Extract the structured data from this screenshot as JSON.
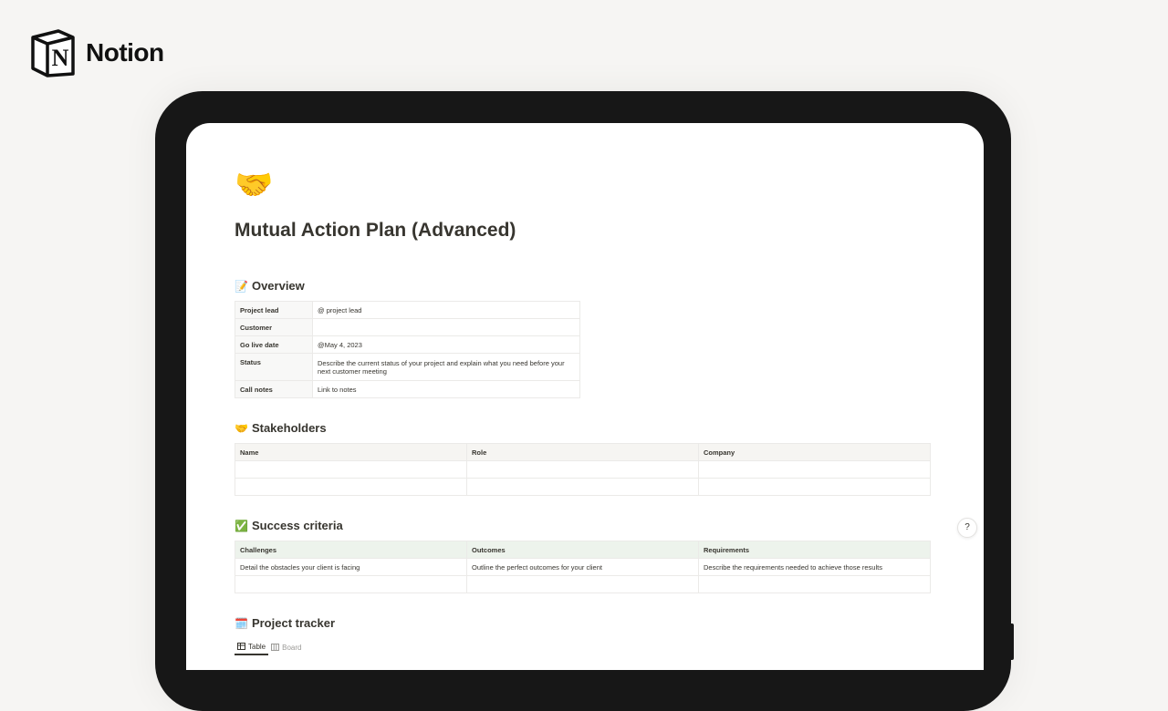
{
  "brand": {
    "name": "Notion",
    "logo_icon": "notion-logo-icon"
  },
  "page": {
    "emoji": "🤝",
    "title": "Mutual Action Plan (Advanced)"
  },
  "overview": {
    "heading": "Overview",
    "emoji": "📝",
    "rows": [
      {
        "key": "Project lead",
        "value": "@ project lead"
      },
      {
        "key": "Customer",
        "value": ""
      },
      {
        "key": "Go live date",
        "value": "@May 4, 2023"
      },
      {
        "key": "Status",
        "value": "Describe the current status of your project and explain what you need before your next customer meeting"
      },
      {
        "key": "Call notes",
        "value": "Link to notes"
      }
    ]
  },
  "stakeholders": {
    "heading": "Stakeholders",
    "emoji": "🤝",
    "columns": [
      "Name",
      "Role",
      "Company"
    ]
  },
  "success": {
    "heading": "Success criteria",
    "emoji": "✅",
    "columns": [
      "Challenges",
      "Outcomes",
      "Requirements"
    ],
    "rows": [
      [
        "Detail the obstacles your client is facing",
        "Outline the perfect outcomes for your client",
        "Describe the requirements needed to achieve those results"
      ]
    ]
  },
  "tracker": {
    "heading": "Project tracker",
    "emoji": "🗓️",
    "tabs": [
      {
        "label": "Table",
        "icon": "table-icon"
      },
      {
        "label": "Board",
        "icon": "board-icon"
      }
    ]
  },
  "help_button": {
    "label": "?"
  },
  "colors": {
    "background": "#f6f5f3",
    "device": "#171717",
    "text": "#37352f",
    "success_header": "#edf3ec"
  }
}
